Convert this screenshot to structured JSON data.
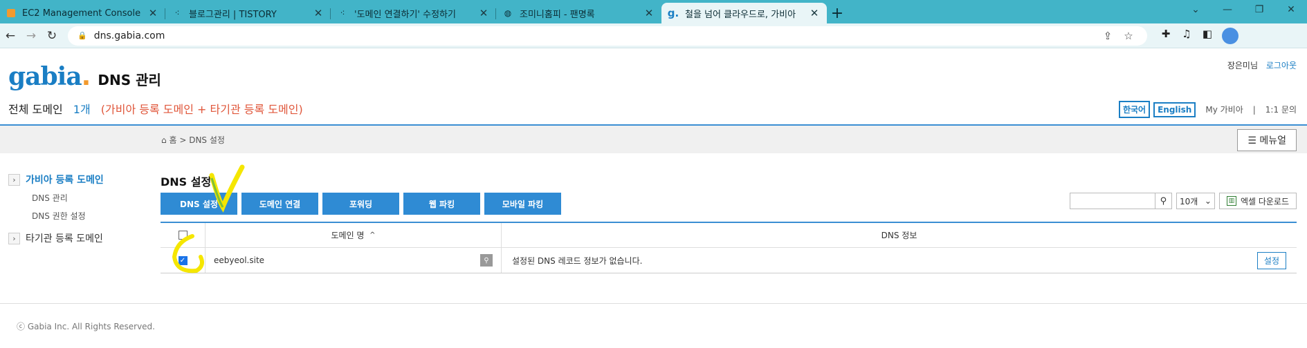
{
  "browser": {
    "tabs": [
      {
        "title": "EC2 Management Console",
        "icon": "aws-icon"
      },
      {
        "title": "블로그관리 | TISTORY",
        "icon": "tistory-icon"
      },
      {
        "title": "'도메인 연결하기' 수정하기",
        "icon": "tistory-icon"
      },
      {
        "title": "조미니홈피 - 팬명록",
        "icon": "globe-icon"
      },
      {
        "title": "철을 넘어 클라우드로, 가비아",
        "icon": "gabia-icon"
      }
    ],
    "url": "dns.gabia.com"
  },
  "header": {
    "logo_text": "gabia",
    "title": "DNS 관리",
    "user_name": "장은미님",
    "logout": "로그아웃",
    "domains_label": "전체 도메인",
    "domains_count": "1개",
    "domains_note": "(가비아 등록 도메인 + 타기관 등록 도메인)",
    "lang_ko": "한국어",
    "lang_en": "English",
    "my_gabia": "My 가비아",
    "sep": "|",
    "support": "1:1 문의"
  },
  "breadcrumb": {
    "home": "홈",
    "sep": ">",
    "current": "DNS 설정"
  },
  "menu_button": "메뉴얼",
  "sidebar": {
    "section1": "가비아 등록 도메인",
    "items": [
      "DNS 관리",
      "DNS 권한 설정"
    ],
    "section2": "타기관 등록 도메인"
  },
  "main": {
    "title": "DNS 설정",
    "action_buttons": [
      "DNS 설정",
      "도메인 연결",
      "포워딩",
      "웹 파킹",
      "모바일 파킹"
    ],
    "page_size": "10개",
    "excel": "엑셀 다운로드",
    "table": {
      "col_domain": "도메인 명",
      "sort_indicator": "^",
      "col_dns": "DNS 정보",
      "rows": [
        {
          "domain": "eebyeol.site",
          "dns_info": "설정된 DNS 레코드 정보가 없습니다.",
          "action": "설정",
          "checked": true
        }
      ]
    }
  },
  "footer": "ⓒ Gabia Inc. All Rights Reserved.",
  "colors": {
    "accent": "#2f8bd4",
    "tab_bar": "#42b4c8",
    "annotation": "#f5e600"
  }
}
